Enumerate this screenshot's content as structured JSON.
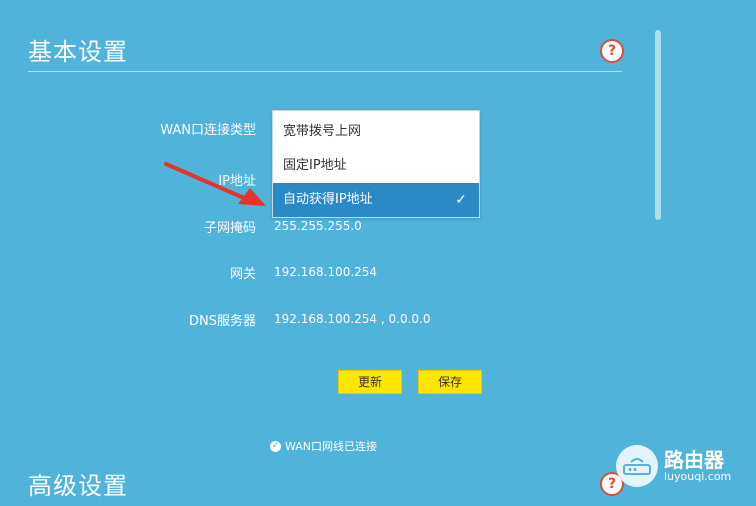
{
  "basic_section": {
    "title": "基本设置",
    "help_icon": "question-mark-icon",
    "help_glyph": "?"
  },
  "form": {
    "wan_type_label": "WAN口连接类型",
    "ip_label": "IP地址",
    "subnet_label": "子网掩码",
    "subnet_value": "255.255.255.0",
    "gateway_label": "网关",
    "gateway_value": "192.168.100.254",
    "dns_label": "DNS服务器",
    "dns_value": "192.168.100.254 , 0.0.0.0"
  },
  "dropdown": {
    "options": [
      "宽带拨号上网",
      "固定IP地址",
      "自动获得IP地址"
    ],
    "selected_index": 2,
    "check_glyph": "✓"
  },
  "buttons": {
    "renew_label": "更新",
    "save_label": "保存"
  },
  "status": {
    "text": "WAN口网线已连接",
    "check_glyph": "✓"
  },
  "advanced_section": {
    "title": "高级设置",
    "help_glyph": "?"
  },
  "watermark": {
    "name": "路由器",
    "site": "luyouqi.com"
  },
  "colors": {
    "background": "#4fb3da",
    "selected_option": "#2a8ac6",
    "button": "#ffe600",
    "arrow": "#e8322a",
    "help_border": "#e24a3a"
  }
}
